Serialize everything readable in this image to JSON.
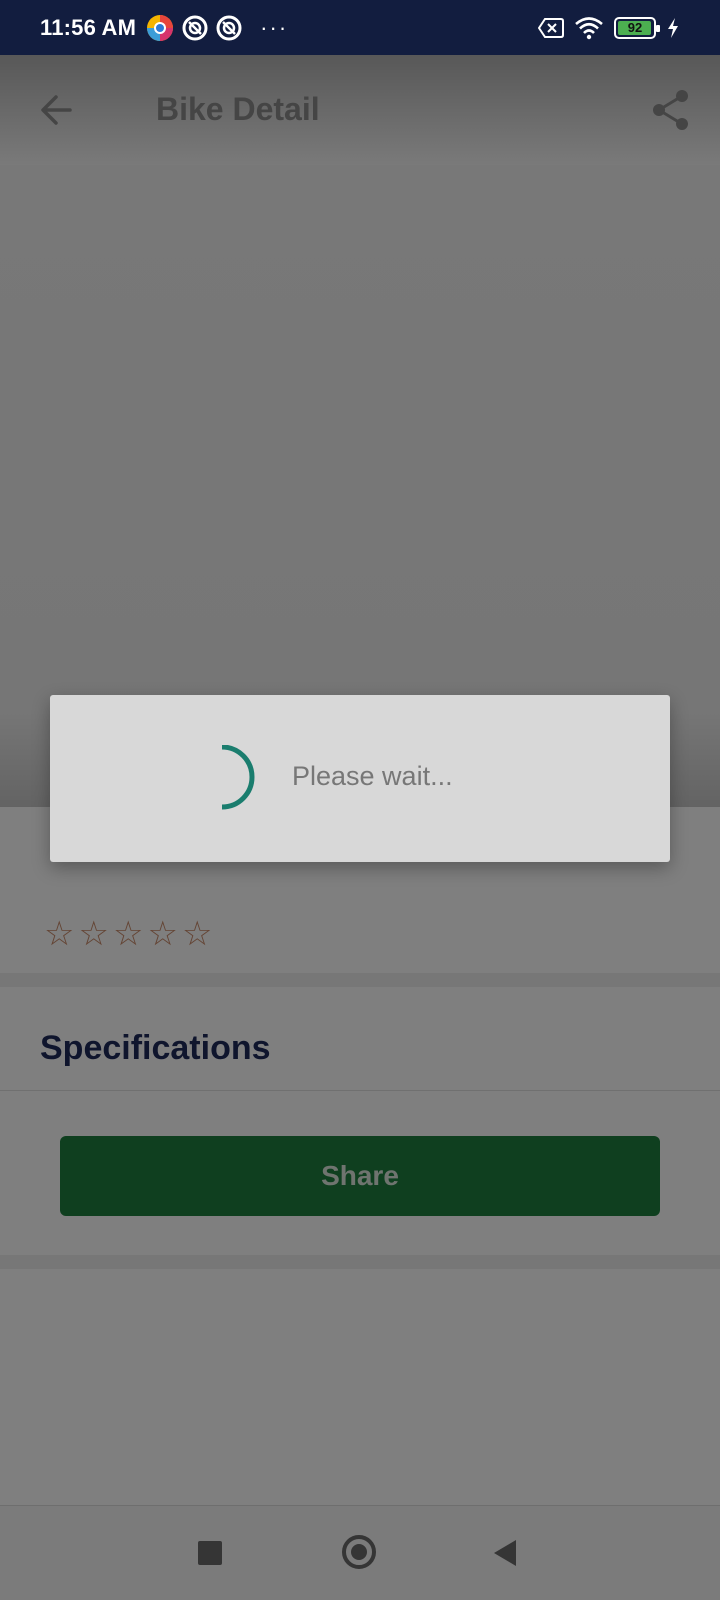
{
  "status_bar": {
    "time": "11:56 AM",
    "battery": "92",
    "icons": [
      "browser-app-icon",
      "notification-icon",
      "notification-icon",
      "more-dots-icon",
      "no-sim-icon",
      "wifi-icon",
      "battery-icon",
      "charging-icon"
    ]
  },
  "toolbar": {
    "title": "Bike Detail",
    "back_icon": "arrow-left-icon",
    "share_icon": "share-icon"
  },
  "detail": {
    "rating_stars": 5,
    "rating_filled": 0,
    "specifications_label": "Specifications",
    "share_button_label": "Share"
  },
  "dialog": {
    "message": "Please wait..."
  },
  "nav_bar": {
    "icons": [
      "recents-square-icon",
      "home-circle-icon",
      "back-triangle-icon"
    ]
  },
  "colors": {
    "status_bar": "#121d3f",
    "share_button": "#1e7e3f",
    "spinner": "#1a7d6e",
    "spec_title": "#1f2a5a",
    "star_outline": "#c98a6a"
  }
}
